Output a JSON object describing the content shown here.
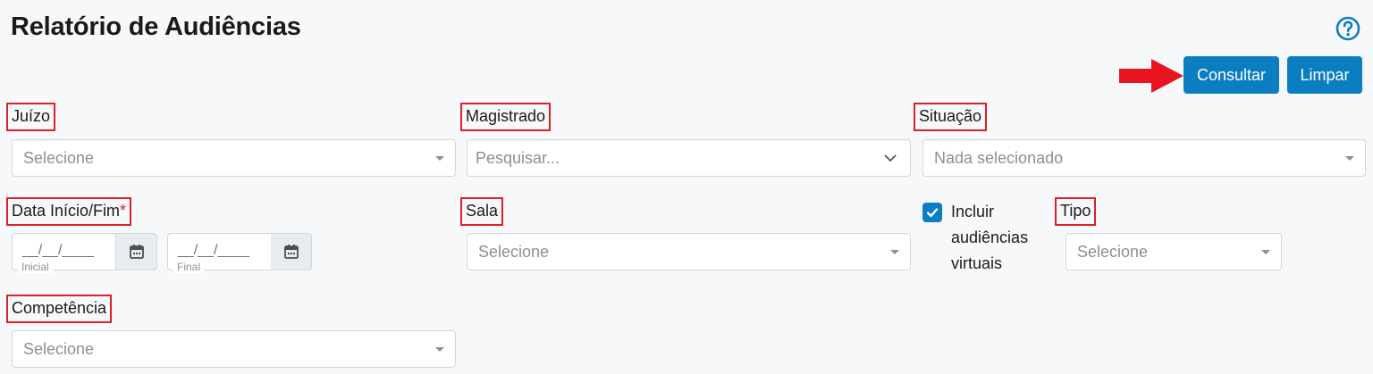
{
  "page": {
    "title": "Relatório de Audiências"
  },
  "toolbar": {
    "consultar_label": "Consultar",
    "limpar_label": "Limpar"
  },
  "fields": {
    "juizo": {
      "label": "Juízo",
      "placeholder": "Selecione"
    },
    "magistrado": {
      "label": "Magistrado",
      "placeholder": "Pesquisar..."
    },
    "situacao": {
      "label": "Situação",
      "placeholder": "Nada selecionado"
    },
    "data": {
      "label": "Data Início/Fim",
      "required_mark": "*",
      "inicio_mask": "__/__/____",
      "inicio_sub": "Inicial",
      "fim_mask": "__/__/____",
      "fim_sub": "Final"
    },
    "sala": {
      "label": "Sala",
      "placeholder": "Selecione"
    },
    "incluir_virtuais": {
      "label": "Incluir audiências virtuais",
      "checked": true
    },
    "tipo": {
      "label": "Tipo",
      "placeholder": "Selecione"
    },
    "competencia": {
      "label": "Competência",
      "placeholder": "Selecione"
    }
  },
  "icons": {
    "help": "question-circle-icon",
    "calendar": "calendar-icon",
    "arrow": "red-arrow-right-icon",
    "check": "check-icon"
  },
  "colors": {
    "primary": "#0b7ec1",
    "highlight": "#d9202b",
    "background": "#f7f8f9"
  }
}
